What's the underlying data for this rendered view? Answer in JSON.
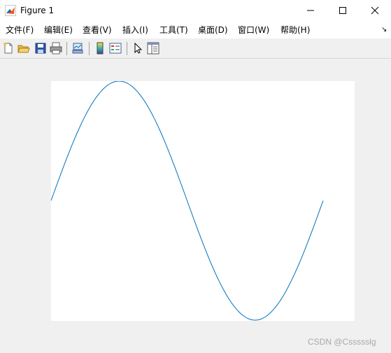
{
  "window": {
    "title": "Figure 1"
  },
  "menu": {
    "items": [
      {
        "label": "文件(F)"
      },
      {
        "label": "编辑(E)"
      },
      {
        "label": "查看(V)"
      },
      {
        "label": "插入(I)"
      },
      {
        "label": "工具(T)"
      },
      {
        "label": "桌面(D)"
      },
      {
        "label": "窗口(W)"
      },
      {
        "label": "帮助(H)"
      }
    ],
    "dock_icon": "↘"
  },
  "toolbar": {
    "icons": [
      "new-figure-icon",
      "open-file-icon",
      "save-icon",
      "print-icon",
      "link-plot-icon",
      "insert-colorbar-icon",
      "insert-legend-icon",
      "edit-plot-icon",
      "property-inspector-icon"
    ]
  },
  "chart_data": {
    "type": "line",
    "function": "sin(x)",
    "xlim": [
      0,
      6.2832
    ],
    "ylim": [
      -1,
      1
    ],
    "x": [
      0,
      0.3142,
      0.6283,
      0.9425,
      1.2566,
      1.5708,
      1.885,
      2.1991,
      2.5133,
      2.8274,
      3.1416,
      3.4558,
      3.7699,
      4.0841,
      4.3982,
      4.7124,
      5.0265,
      5.3407,
      5.6549,
      5.969,
      6.2832
    ],
    "y": [
      0,
      0.309,
      0.5878,
      0.809,
      0.9511,
      1,
      0.9511,
      0.809,
      0.5878,
      0.309,
      0,
      -0.309,
      -0.5878,
      -0.809,
      -0.9511,
      -1,
      -0.9511,
      -0.809,
      -0.5878,
      -0.309,
      0
    ],
    "line_color": "#0072bd",
    "grid": false,
    "title": "",
    "xlabel": "",
    "ylabel": ""
  },
  "watermark": "CSDN @Cssssslg"
}
